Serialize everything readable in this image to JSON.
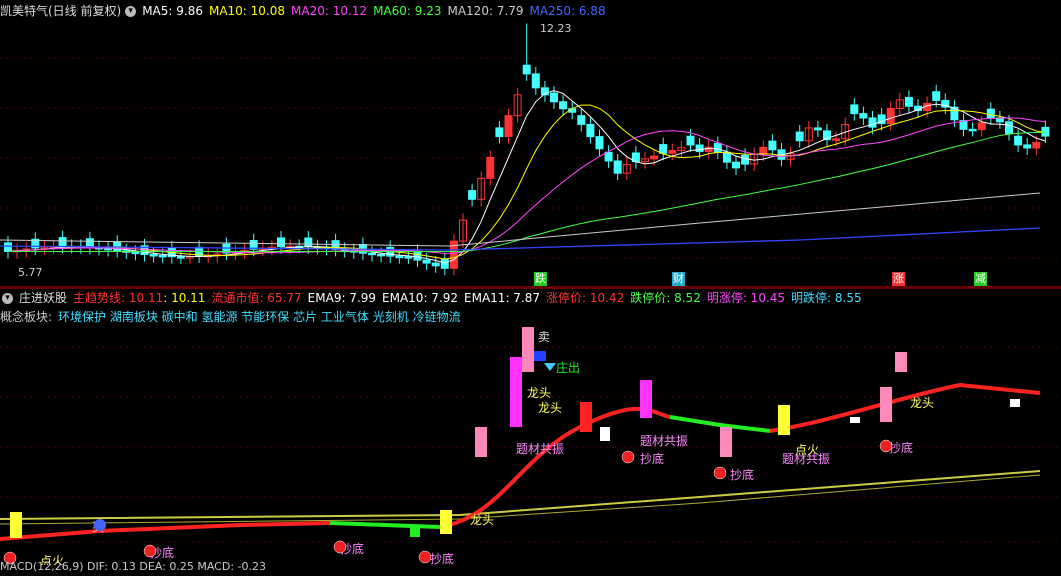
{
  "top_header": {
    "title": "凯美特气(日线 前复权)",
    "ma5": "MA5: 9.86",
    "ma10": "MA10: 10.08",
    "ma20": "MA20: 10.12",
    "ma60": "MA60: 9.23",
    "ma120": "MA120: 7.79",
    "ma250": "MA250: 6.88"
  },
  "price_labels": {
    "high": "12.23",
    "low": "5.77"
  },
  "bottom_markers": [
    {
      "text": "跌",
      "color": "#22cc22"
    },
    {
      "text": "财",
      "color": "#22aacc"
    },
    {
      "text": "涨",
      "color": "#ee3333"
    },
    {
      "text": "减",
      "color": "#22cc22"
    }
  ],
  "indicator_header": {
    "name": "庄进妖股",
    "trend": "主趋势线: 10.11",
    "trend2": ": 10.11",
    "mcap": "流通市值: 65.77",
    "ema9": "EMA9: 7.99",
    "ema10": "EMA10: 7.92",
    "ema11": "EMA11: 7.87",
    "up_stop": "涨停价: 10.42",
    "down_stop": "跌停价: 8.52",
    "next_up": "明涨停: 10.45",
    "next_down": "明跌停: 8.55"
  },
  "concepts": {
    "label": "概念板块:",
    "items": "环境保护 湖南板块 碳中和 氢能源 节能环保 芯片 工业气体 光刻机 冷链物流"
  },
  "signals": {
    "sell": "卖",
    "zhuang_out": "庄出",
    "dragon": "龙头",
    "theme": "题材共振",
    "bottom": "抄底",
    "ignite": "点火",
    "buy": "买"
  },
  "footer_text": "MACD(12,26,9)  DIF: 0.13  DEA: 0.25  MACD: -0.23",
  "colors": {
    "up": "#ff3333",
    "down": "#44ffff",
    "ma5": "#ffffff",
    "ma10": "#ffff00",
    "ma20": "#ff44ff",
    "ma60": "#44ff44",
    "ma120": "#cccccc",
    "ma250": "#3344ff"
  }
}
